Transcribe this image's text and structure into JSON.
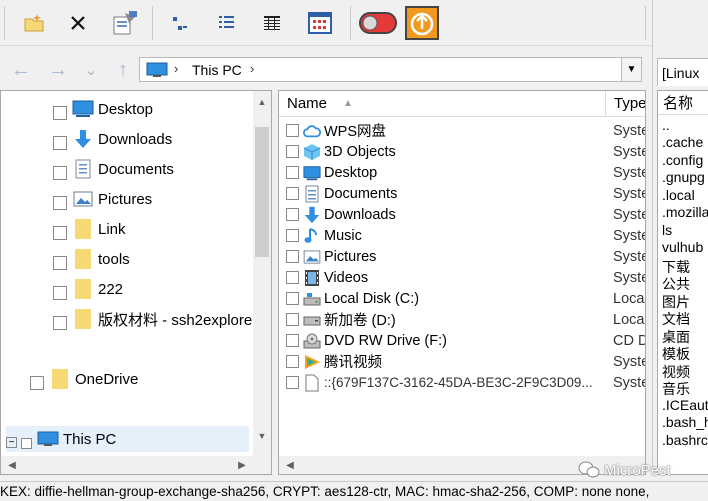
{
  "toolbar": {
    "buttons": [
      "new-folder",
      "delete",
      "properties",
      "small-icons",
      "list-view",
      "details-view",
      "thumbnails-view",
      "toggle",
      "upload"
    ]
  },
  "address": {
    "path": "This PC"
  },
  "tree": {
    "items": [
      {
        "label": "Desktop",
        "icon": "desktop-icon"
      },
      {
        "label": "Downloads",
        "icon": "downloads-icon"
      },
      {
        "label": "Documents",
        "icon": "documents-icon"
      },
      {
        "label": "Pictures",
        "icon": "pictures-icon"
      },
      {
        "label": "Link",
        "icon": "folder-icon"
      },
      {
        "label": "tools",
        "icon": "folder-icon"
      },
      {
        "label": "222",
        "icon": "folder-icon"
      },
      {
        "label": "版权材料 - ssh2explore",
        "icon": "folder-icon"
      },
      {
        "label": "OneDrive",
        "icon": "folder-icon"
      },
      {
        "label": "This PC",
        "icon": "pc-icon"
      }
    ]
  },
  "files": {
    "columns": {
      "name": "Name",
      "type": "Type"
    },
    "rows": [
      {
        "name": "WPS网盘",
        "type": "Syste",
        "icon": "cloud-icon"
      },
      {
        "name": "3D Objects",
        "type": "Syste",
        "icon": "3d-objects-icon"
      },
      {
        "name": "Desktop",
        "type": "Syste",
        "icon": "desktop-icon"
      },
      {
        "name": "Documents",
        "type": "Syste",
        "icon": "documents-icon"
      },
      {
        "name": "Downloads",
        "type": "Syste",
        "icon": "downloads-icon"
      },
      {
        "name": "Music",
        "type": "Syste",
        "icon": "music-icon"
      },
      {
        "name": "Pictures",
        "type": "Syste",
        "icon": "pictures-icon"
      },
      {
        "name": "Videos",
        "type": "Syste",
        "icon": "videos-icon"
      },
      {
        "name": "Local Disk (C:)",
        "type": "Loca",
        "icon": "disk-icon"
      },
      {
        "name": "新加卷 (D:)",
        "type": "Loca",
        "icon": "disk-icon"
      },
      {
        "name": "DVD RW Drive (F:)",
        "type": "CD D",
        "icon": "dvd-icon"
      },
      {
        "name": "腾讯视频",
        "type": "Syste",
        "icon": "tencent-video-icon"
      },
      {
        "name": "::{679F137C-3162-45DA-BE3C-2F9C3D09...",
        "type": "Syste",
        "icon": "file-icon"
      }
    ]
  },
  "remote": {
    "tab": "[Linux",
    "column": "名称",
    "items": [
      "..",
      ".cache",
      ".config",
      ".gnupg",
      ".local",
      ".mozilla",
      "ls",
      "vulhub",
      "下载",
      "公共",
      "图片",
      "文档",
      "桌面",
      "模板",
      "视频",
      "音乐",
      ".ICEauth",
      ".bash_h",
      ".bashrc"
    ]
  },
  "status": {
    "text": "KEX: diffie-hellman-group-exchange-sha256, CRYPT: aes128-ctr, MAC: hmac-sha2-256, COMP: none none,"
  },
  "watermark": "MicroPest",
  "colors": {
    "folder": "#f8d775",
    "blue_accent": "#1e78d7",
    "toggle_red": "#e53a3a",
    "upload_orange": "#f29a1f"
  }
}
